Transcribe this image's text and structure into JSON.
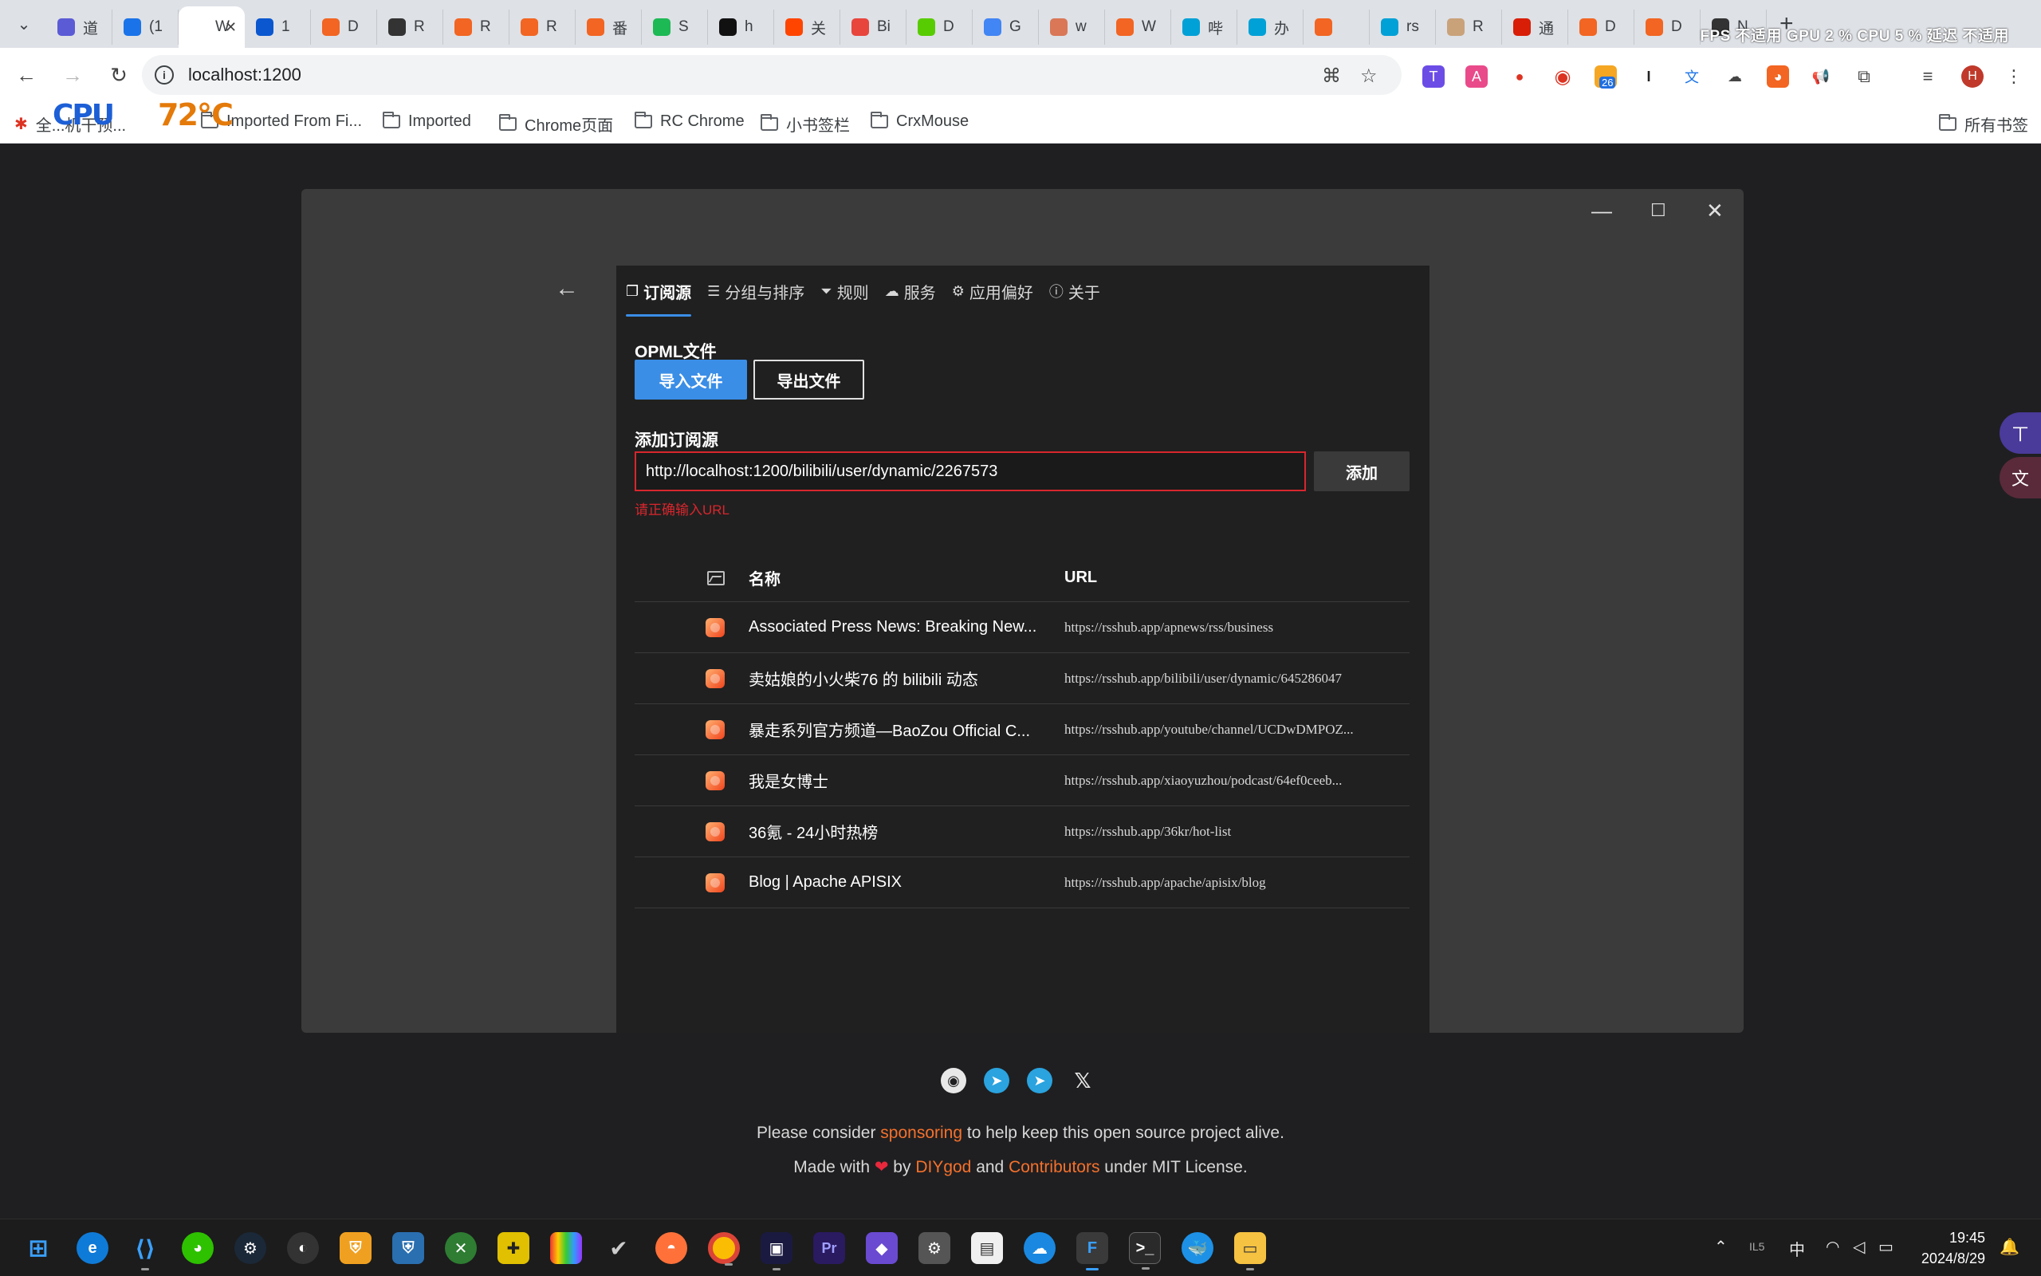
{
  "browser": {
    "active_tab_title": "W",
    "tabs": [
      {
        "label": "道",
        "color": "#5b5bd6"
      },
      {
        "label": "(1",
        "color": "#1a73e8"
      },
      {
        "label": "W",
        "color": "#ffffff"
      },
      {
        "label": "1",
        "color": "#0b57d0"
      },
      {
        "label": "D",
        "color": "#f26522"
      },
      {
        "label": "R",
        "color": "#333333"
      },
      {
        "label": "R",
        "color": "#f26522"
      },
      {
        "label": "R",
        "color": "#f26522"
      },
      {
        "label": "番",
        "color": "#f26522"
      },
      {
        "label": "S",
        "color": "#1db954"
      },
      {
        "label": "h",
        "color": "#111111"
      },
      {
        "label": "关",
        "color": "#ff4500"
      },
      {
        "label": "Bi",
        "color": "#e8453c"
      },
      {
        "label": "D",
        "color": "#58cc02"
      },
      {
        "label": "G",
        "color": "#4285f4"
      },
      {
        "label": "w",
        "color": "#d97757"
      },
      {
        "label": "W",
        "color": "#f26522"
      },
      {
        "label": "哔",
        "color": "#00a1d6"
      },
      {
        "label": "办",
        "color": "#00a1d6"
      },
      {
        "label": "",
        "color": "#f26522"
      },
      {
        "label": "rs",
        "color": "#00a1d6"
      },
      {
        "label": "R",
        "color": "#c9a27a"
      },
      {
        "label": "通",
        "color": "#d81e06"
      },
      {
        "label": "D",
        "color": "#f26522"
      },
      {
        "label": "D",
        "color": "#f26522"
      },
      {
        "label": "N",
        "color": "#333333"
      }
    ],
    "new_tab_symbol": "+",
    "sysmon_text": "FPS 不适用  GPU  2 %  CPU  5 %  延迟 不适用",
    "url": "localhost:1200",
    "extension_badge": "26",
    "profile_initial": "H",
    "bookmarks": [
      {
        "label": "全...机干预...",
        "type": "link"
      },
      {
        "label": "Imported From Fi...",
        "type": "folder"
      },
      {
        "label": "Imported",
        "type": "folder"
      },
      {
        "label": "Chrome页面",
        "type": "folder"
      },
      {
        "label": "RC Chrome",
        "type": "folder"
      },
      {
        "label": "小书签栏",
        "type": "folder"
      },
      {
        "label": "CrxMouse",
        "type": "folder"
      }
    ],
    "all_bookmarks": "所有书签",
    "overlay_cpu": "CPU",
    "overlay_temp": "72℃"
  },
  "app": {
    "tabs": [
      {
        "label": "订阅源",
        "icon": "rss-feed-icon",
        "glyph": "❐",
        "active": true
      },
      {
        "label": "分组与排序",
        "icon": "list-icon",
        "glyph": "☰",
        "active": false
      },
      {
        "label": "规则",
        "icon": "filter-icon",
        "glyph": "⏷",
        "active": false
      },
      {
        "label": "服务",
        "icon": "cloud-icon",
        "glyph": "☁",
        "active": false
      },
      {
        "label": "应用偏好",
        "icon": "gear-icon",
        "glyph": "⚙",
        "active": false
      },
      {
        "label": "关于",
        "icon": "info-icon",
        "glyph": "ⓘ",
        "active": false
      }
    ],
    "opml": {
      "title": "OPML文件",
      "import_label": "导入文件",
      "export_label": "导出文件"
    },
    "add_source": {
      "title": "添加订阅源",
      "input_value": "http://localhost:1200/bilibili/user/dynamic/2267573",
      "add_label": "添加",
      "error": "请正确输入URL"
    },
    "table": {
      "col_name": "名称",
      "col_url": "URL",
      "rows": [
        {
          "name": "Associated Press News: Breaking New...",
          "url": "https://rsshub.app/apnews/rss/business"
        },
        {
          "name": "卖姑娘的小火柴76 的 bilibili 动态",
          "url": "https://rsshub.app/bilibili/user/dynamic/645286047"
        },
        {
          "name": "暴走系列官方频道—BaoZou Official C...",
          "url": "https://rsshub.app/youtube/channel/UCDwDMPOZ..."
        },
        {
          "name": "我是女博士",
          "url": "https://rsshub.app/xiaoyuzhou/podcast/64ef0ceeb..."
        },
        {
          "name": "36氪 - 24小时热榜",
          "url": "https://rsshub.app/36kr/hot-list"
        },
        {
          "name": "Blog | Apache APISIX",
          "url": "https://rsshub.app/apache/apisix/blog"
        }
      ]
    }
  },
  "footer": {
    "line1_pre": "Please consider ",
    "line1_link": "sponsoring",
    "line1_post": " to help keep this open source project alive.",
    "line2_pre": "Made with ",
    "line2_heart": "❤",
    "line2_by": " by ",
    "line2_author": "DIYgod",
    "line2_and": " and ",
    "line2_contrib": "Contributors",
    "line2_post": " under MIT License."
  },
  "taskbar": {
    "ime": "中",
    "tray_temp": "IL5",
    "time": "19:45",
    "date": "2024/8/29"
  }
}
